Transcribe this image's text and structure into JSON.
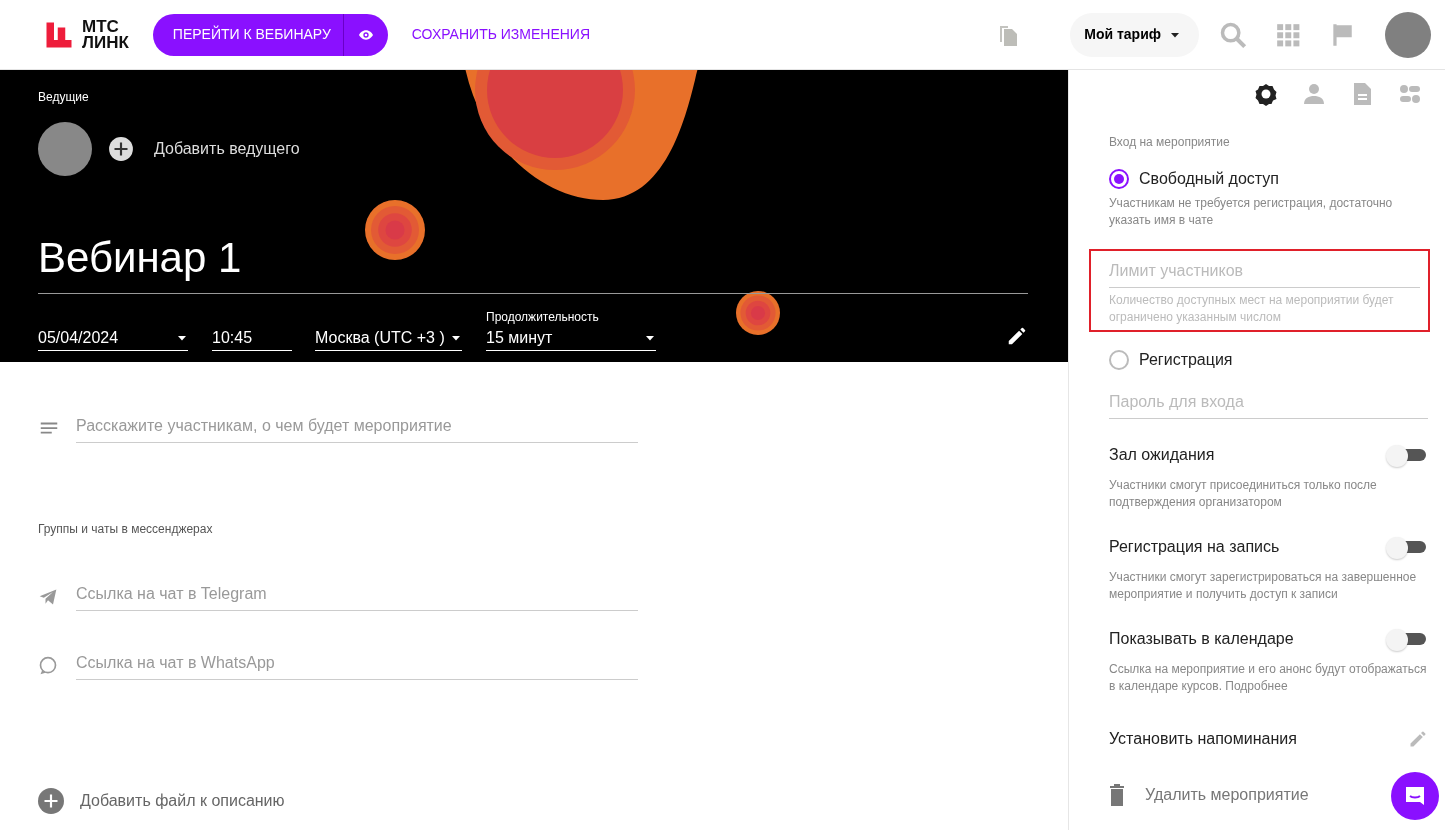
{
  "header": {
    "logo": {
      "line1": "МТС",
      "line2": "ЛИНК"
    },
    "go_button": "ПЕРЕЙТИ К ВЕБИНАРУ",
    "save_link": "СОХРАНИТЬ ИЗМЕНЕНИЯ",
    "tariff": "Мой тариф"
  },
  "hero": {
    "hosts_label": "Ведущие",
    "add_host": "Добавить ведущего",
    "title": "Вебинар 1",
    "fields": [
      {
        "kind": "select",
        "value": "05/04/2024"
      },
      {
        "kind": "text",
        "value": "10:45"
      },
      {
        "kind": "select",
        "value": "Москва (UTC +3 )"
      },
      {
        "kind": "select",
        "label": "Продолжительность",
        "value": "15 минут"
      }
    ]
  },
  "description": {
    "placeholder": "Расскажите участникам, о чем будет мероприятие"
  },
  "messengers": {
    "label": "Группы и чаты в мессенджерах",
    "items": [
      {
        "kind": "telegram",
        "placeholder": "Ссылка на чат в Telegram"
      },
      {
        "kind": "whatsapp",
        "placeholder": "Ссылка на чат в WhatsApp"
      }
    ]
  },
  "add_file": "Добавить файл к описанию",
  "sidebar": {
    "tabs": [
      {
        "kind": "settings",
        "selected": true
      },
      {
        "kind": "person",
        "selected": false
      },
      {
        "kind": "document",
        "selected": false
      },
      {
        "kind": "toggles",
        "selected": false
      }
    ],
    "section_label": "Вход на мероприятие",
    "items": [
      {
        "kind": "radio",
        "label": "Свободный доступ",
        "selected": true,
        "hint": "Участникам не требуется регистрация, достаточно указать имя в чате"
      },
      {
        "kind": "field",
        "placeholder": "Лимит участников",
        "hint": "Количество доступных мест на мероприятии будет ограничено указанным числом",
        "highlighted": true
      },
      {
        "kind": "radio",
        "label": "Регистрация",
        "selected": false
      },
      {
        "kind": "field",
        "placeholder": "Пароль для входа",
        "highlighted": false
      },
      {
        "kind": "toggle",
        "label": "Зал ожидания",
        "on": false,
        "hint": "Участники смогут присоединиться только после подтверждения организатором"
      },
      {
        "kind": "toggle",
        "label": "Регистрация на запись",
        "on": false,
        "hint": "Участники смогут зарегистрироваться на завершенное мероприятие и получить доступ к записи"
      },
      {
        "kind": "toggle",
        "label": "Показывать в календаре",
        "on": false,
        "hint": "Ссылка на мероприятие и его анонс будут отображаться в календаре курсов. Подробнее"
      },
      {
        "kind": "action",
        "label": "Установить напоминания"
      }
    ],
    "delete": "Удалить мероприятие"
  }
}
